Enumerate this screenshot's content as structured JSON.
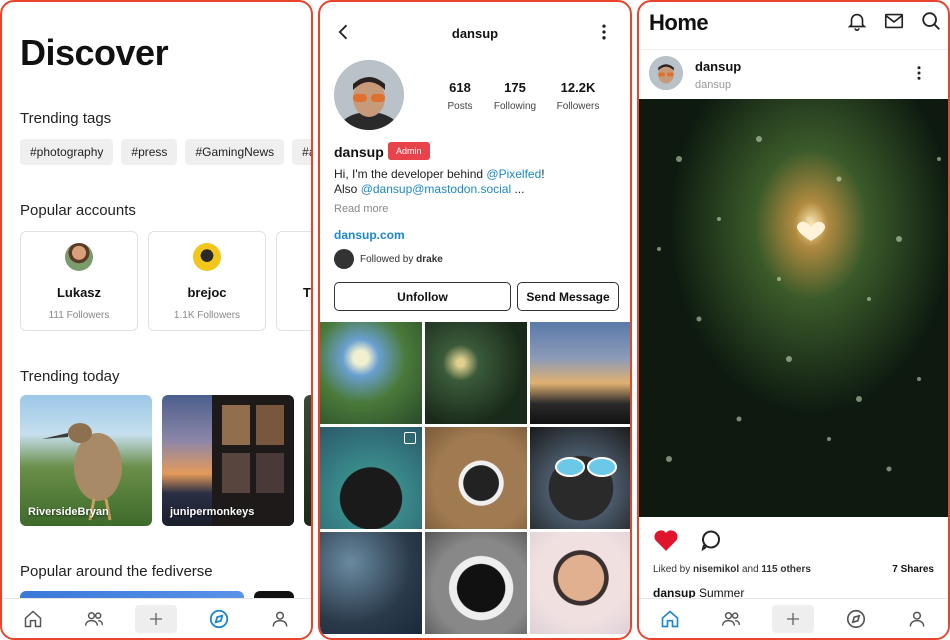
{
  "discover": {
    "title": "Discover",
    "trending_tags_title": "Trending tags",
    "tags": [
      "#photography",
      "#press",
      "#GamingNews",
      "#a"
    ],
    "popular_accounts_title": "Popular accounts",
    "accounts": [
      {
        "name": "Lukasz",
        "followers": "111 Followers"
      },
      {
        "name": "brejoc",
        "followers": "1.1K Followers"
      },
      {
        "name": "T",
        "followers": ""
      }
    ],
    "trending_today_title": "Trending today",
    "trending": [
      {
        "label": "RiversideBryan"
      },
      {
        "label": "junipermonkeys"
      }
    ],
    "popular_fediverse_title": "Popular around the fediverse"
  },
  "profile": {
    "username": "dansup",
    "stats": [
      {
        "value": "618",
        "label": "Posts"
      },
      {
        "value": "175",
        "label": "Following"
      },
      {
        "value": "12.2K",
        "label": "Followers"
      }
    ],
    "display_name": "dansup",
    "badge": "Admin",
    "bio_line1_prefix": "Hi, I'm the developer behind ",
    "bio_line1_link": "@Pixelfed",
    "bio_line1_suffix": "!",
    "bio_line2_prefix": "Also ",
    "bio_line2_link": "@dansup@mastodon.social",
    "bio_line2_suffix": " ...",
    "read_more": "Read more",
    "website": "dansup.com",
    "followed_by_prefix": "Followed by ",
    "followed_by_name": "drake",
    "unfollow_label": "Unfollow",
    "message_label": "Send Message"
  },
  "home": {
    "title": "Home",
    "post": {
      "author": "dansup",
      "handle": "dansup",
      "liked_by_prefix": "Liked by ",
      "liked_by_user": "nisemikol",
      "liked_by_middle": " and ",
      "liked_by_others": "115 others",
      "shares": "7 Shares",
      "caption_author": "dansup",
      "caption_text": " Summer"
    }
  },
  "colors": {
    "accent_red": "#e8432b",
    "link_blue": "#1c87c9",
    "admin_badge": "#e8434b",
    "heart_red": "#e0152d",
    "nav_active_blue": "#1c87c9"
  },
  "icons": [
    "back-arrow-icon",
    "more-vertical-icon",
    "home-icon",
    "people-icon",
    "plus-icon",
    "compass-icon",
    "person-icon",
    "bell-icon",
    "mail-icon",
    "search-icon",
    "heart-icon",
    "comment-icon",
    "album-icon"
  ]
}
